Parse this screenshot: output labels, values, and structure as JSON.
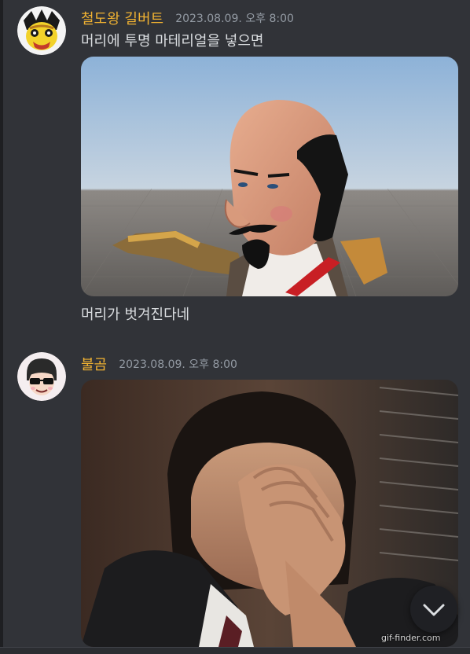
{
  "messages": [
    {
      "username": "철도왕 길버트",
      "timestamp": "2023.08.09. 오후 8:00",
      "text": "머리에 투명 마테리얼을 넣으면",
      "caption": "머리가 벗겨진다네"
    },
    {
      "username": "불곰",
      "timestamp": "2023.08.09. 오후 8:00",
      "gif_watermark": "gif-finder.com"
    }
  ],
  "icons": {
    "scroll_down": "chevron-down-icon"
  },
  "colors": {
    "background": "#313338",
    "username": "#f0b232",
    "timestamp": "#949ba4",
    "text": "#dbdee1"
  }
}
